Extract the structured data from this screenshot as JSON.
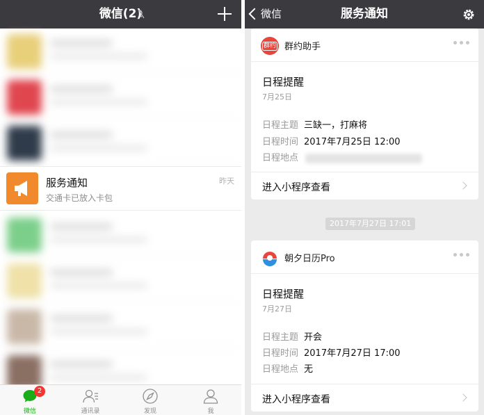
{
  "left": {
    "nav": {
      "title": "微信(2)"
    },
    "service_row": {
      "name": "服务通知",
      "preview": "交通卡已放入卡包",
      "time": "昨天"
    },
    "tabs": [
      {
        "label": "微信",
        "badge": "2",
        "icon": "chat-icon",
        "active": true
      },
      {
        "label": "通讯录",
        "icon": "contacts-icon"
      },
      {
        "label": "发现",
        "icon": "compass-icon"
      },
      {
        "label": "我",
        "icon": "profile-icon"
      }
    ]
  },
  "right": {
    "nav": {
      "back_label": "微信",
      "title": "服务通知"
    },
    "cards": [
      {
        "app_name": "群约助手",
        "logo_text": "群约",
        "title": "日程提醒",
        "date": "7月25日",
        "fields": [
          {
            "key": "日程主题",
            "value": "三缺一，打麻将"
          },
          {
            "key": "日程时间",
            "value": "2017年7月25日 12:00"
          },
          {
            "key": "日程地点",
            "value": ""
          }
        ],
        "footer": "进入小程序查看"
      },
      {
        "app_name": "朝夕日历Pro",
        "title": "日程提醒",
        "date": "7月27日",
        "fields": [
          {
            "key": "日程主题",
            "value": "开会"
          },
          {
            "key": "日程时间",
            "value": "2017年7月27日 17:00"
          },
          {
            "key": "日程地点",
            "value": "无"
          }
        ],
        "footer": "进入小程序查看"
      }
    ],
    "timestamp": "2017年7月27日 17:01"
  },
  "colors": {
    "navbar": "#3b3a3f",
    "accent_green": "#1aad19",
    "badge_red": "#f43530",
    "service_orange": "#f08a2d",
    "chat_bg": "#ebebeb"
  }
}
